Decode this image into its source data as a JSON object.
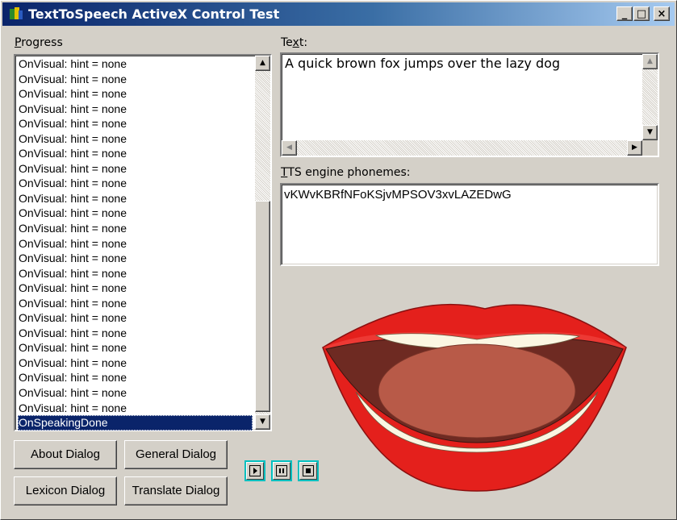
{
  "window": {
    "title": "TextToSpeech ActiveX Control Test",
    "controls": {
      "minimize": "_",
      "maximize": "□",
      "close": "×"
    }
  },
  "progress": {
    "label_first": "P",
    "label_rest": "rogress",
    "items": [
      "OnVisual: hint = none",
      "OnVisual: hint = none",
      "OnVisual: hint = none",
      "OnVisual: hint = none",
      "OnVisual: hint = none",
      "OnVisual: hint = none",
      "OnVisual: hint = none",
      "OnVisual: hint = none",
      "OnVisual: hint = none",
      "OnVisual: hint = none",
      "OnVisual: hint = none",
      "OnVisual: hint = none",
      "OnVisual: hint = none",
      "OnVisual: hint = none",
      "OnVisual: hint = none",
      "OnVisual: hint = none",
      "OnVisual: hint = none",
      "OnVisual: hint = none",
      "OnVisual: hint = none",
      "OnVisual: hint = none",
      "OnVisual: hint = none",
      "OnVisual: hint = none",
      "OnVisual: hint = none",
      "OnVisual: hint = none"
    ],
    "selected_item": "OnSpeakingDone"
  },
  "text_section": {
    "label_pre": "Te",
    "label_ul": "x",
    "label_post": "t:",
    "value": "A quick brown fox jumps over the lazy dog"
  },
  "phonemes_section": {
    "label_ul": "T",
    "label_rest": "TS engine phonemes:",
    "value": "vKWvKBRfNFoKSjvMPSOV3xvLAZEDwG"
  },
  "buttons": {
    "about": "About Dialog",
    "general": "General Dialog",
    "lexicon": "Lexicon Dialog",
    "translate": "Translate Dialog"
  },
  "media": {
    "play": "play-icon",
    "pause": "pause-icon",
    "stop": "stop-icon"
  },
  "colors": {
    "titlebar_start": "#0a246a",
    "selection": "#0a246a",
    "lips": "#e4201c",
    "mouth_inside": "#6e2a22",
    "tongue": "#b85a48",
    "teeth": "#fbf6e2",
    "media_outline": "#00bfbf"
  }
}
